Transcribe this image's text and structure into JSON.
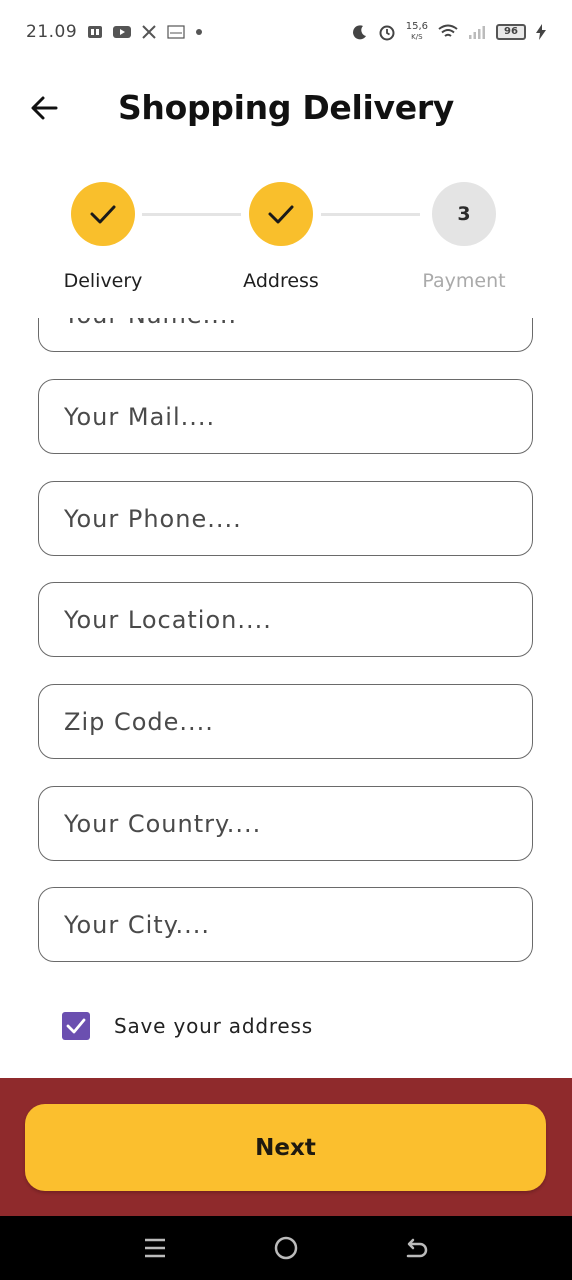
{
  "status_bar": {
    "time": "21.09",
    "net_speed_value": "15,6",
    "net_speed_unit": "K/S",
    "battery": "96",
    "notification_icons": [
      "message-icon",
      "youtube-icon",
      "x-icon",
      "kuk-icon",
      "dot-icon"
    ],
    "system_icons": [
      "moon-icon",
      "alarm-icon",
      "wifi-icon",
      "signal-icon",
      "battery-icon",
      "charging-icon"
    ]
  },
  "header": {
    "title": "Shopping Delivery",
    "back_icon": "arrow-left-icon"
  },
  "stepper": {
    "steps": [
      {
        "label": "Delivery",
        "state": "done"
      },
      {
        "label": "Address",
        "state": "done"
      },
      {
        "label": "Payment",
        "state": "pending",
        "number": "3"
      }
    ]
  },
  "form": {
    "fields": [
      {
        "placeholder": "Your Name...."
      },
      {
        "placeholder": "Your Mail...."
      },
      {
        "placeholder": "Your Phone...."
      },
      {
        "placeholder": "Your Location...."
      },
      {
        "placeholder": "Zip Code...."
      },
      {
        "placeholder": "Your Country...."
      },
      {
        "placeholder": "Your City...."
      }
    ],
    "save_address": {
      "label": "Save your address",
      "checked": true
    }
  },
  "footer": {
    "next_label": "Next"
  },
  "colors": {
    "accent_yellow": "#f9bf2c",
    "footer_maroon": "#8f2a2c",
    "checkbox_purple": "#6b4fb0",
    "inactive_gray": "#e4e4e4"
  },
  "nav_bar": {
    "icons": [
      "menu-icon",
      "home-icon",
      "back-nav-icon"
    ]
  }
}
